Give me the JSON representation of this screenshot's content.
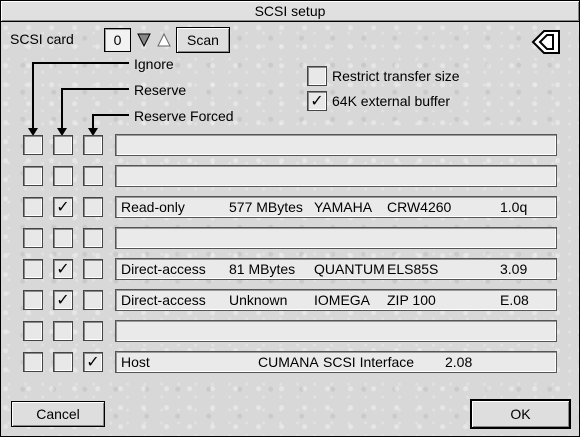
{
  "window": {
    "title": "SCSI setup"
  },
  "scsi_card": {
    "label": "SCSI card",
    "value": "0",
    "scan_label": "Scan"
  },
  "columns": {
    "ignore": "Ignore",
    "reserve": "Reserve",
    "reserve_forced": "Reserve Forced"
  },
  "options": {
    "restrict_transfer_size": {
      "label": "Restrict transfer size",
      "checked": false
    },
    "external_buffer": {
      "label": "64K external buffer",
      "checked": true
    }
  },
  "devices": [
    {
      "ignore": false,
      "reserve": false,
      "forced": false,
      "type": "",
      "size": "",
      "vendor": "",
      "product": "",
      "rev": ""
    },
    {
      "ignore": false,
      "reserve": false,
      "forced": false,
      "type": "",
      "size": "",
      "vendor": "",
      "product": "",
      "rev": ""
    },
    {
      "ignore": false,
      "reserve": true,
      "forced": false,
      "type": "Read-only",
      "size": "577 MBytes",
      "vendor": "YAMAHA",
      "product": "CRW4260",
      "rev": "1.0q"
    },
    {
      "ignore": false,
      "reserve": false,
      "forced": false,
      "type": "",
      "size": "",
      "vendor": "",
      "product": "",
      "rev": ""
    },
    {
      "ignore": false,
      "reserve": true,
      "forced": false,
      "type": "Direct-access",
      "size": "81 MBytes",
      "vendor": "QUANTUM",
      "product": "ELS85S",
      "rev": "3.09"
    },
    {
      "ignore": false,
      "reserve": true,
      "forced": false,
      "type": "Direct-access",
      "size": "Unknown",
      "vendor": "IOMEGA",
      "product": "ZIP 100",
      "rev": "E.08"
    },
    {
      "ignore": false,
      "reserve": false,
      "forced": false,
      "type": "",
      "size": "",
      "vendor": "",
      "product": "",
      "rev": ""
    },
    {
      "ignore": false,
      "reserve": false,
      "forced": true,
      "type": "Host",
      "size": "",
      "vendor": "CUMANA",
      "product": "SCSI Interface",
      "rev": "2.08"
    }
  ],
  "buttons": {
    "cancel": "Cancel",
    "ok": "OK"
  },
  "colors": {
    "tick": "#000000",
    "window_bg": "#d8d8d8"
  }
}
